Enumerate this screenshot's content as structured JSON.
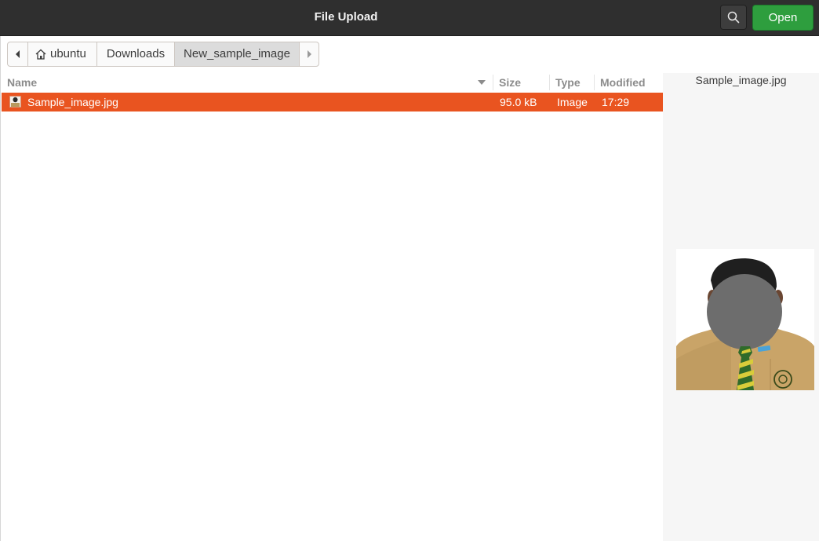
{
  "header": {
    "title": "File Upload",
    "open_label": "Open",
    "search_icon": "search-icon"
  },
  "pathbar": {
    "back_icon": "chevron-left-icon",
    "forward_icon": "chevron-right-icon",
    "home_icon": "home-icon",
    "crumbs": [
      "ubuntu",
      "Downloads",
      "New_sample_image"
    ]
  },
  "columns": {
    "name": "Name",
    "size": "Size",
    "type": "Type",
    "modified": "Modified"
  },
  "files": [
    {
      "name": "Sample_image.jpg",
      "size": "95.0 kB",
      "type": "Image",
      "modified": "17:29",
      "selected": true
    }
  ],
  "preview": {
    "filename": "Sample_image.jpg"
  },
  "colors": {
    "selection": "#e95420",
    "open_button": "#2e9e3e",
    "header_bg": "#2f2f2f"
  }
}
